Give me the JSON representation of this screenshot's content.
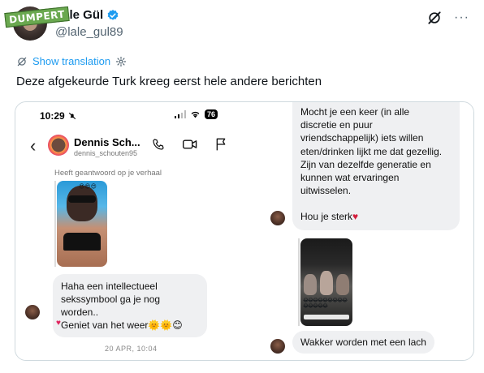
{
  "tweet": {
    "author_name": "Lale Gül",
    "handle": "@lale_gul89",
    "watermark": "DUMPERT",
    "translate_label": "Show translation",
    "text": "Deze afgekeurde Turk kreeg eerst hele andere berichten",
    "more_label": "···"
  },
  "phone": {
    "time": "10:29",
    "battery": "76",
    "chat_name": "Dennis Sch...",
    "chat_username": "dennis_schouten95",
    "reply_note": "Heeft geantwoord op je verhaal",
    "story_emoji": "😍😍😍",
    "msg1_line1": "Haha een intellectueel",
    "msg1_line2": "sekssymbool ga je nog worden..",
    "msg1_line3": "Geniet van het weer🌞🌞😊",
    "msg1_reaction": "♥",
    "timestamp": "20 APR, 10:04",
    "msg2_lines": [
      "Mocht je een keer (in alle",
      "discretie en puur",
      "vriendschappelijk) iets willen",
      "eten/drinken lijkt me dat gezellig.",
      "Zijn van dezelfde generatie en",
      "kunnen wat ervaringen",
      "uitwisselen."
    ],
    "msg2_closing": "Hou je sterk",
    "msg2_heart": "♥",
    "video_emojis": "😂😂😂😂😂😂😂😂😂😂😂😂😂😂",
    "msg3": "Wakker worden met een lach"
  },
  "icons": {
    "verified": "verified-badge-icon",
    "grok": "grok-icon",
    "more": "more-icon",
    "translate": "translate-icon",
    "settings": "gear-icon",
    "back": "chevron-left-icon",
    "phone": "phone-icon",
    "video": "video-icon",
    "flag": "flag-icon"
  },
  "colors": {
    "link": "#1d9bf0",
    "verified": "#1d9bf0",
    "bubble": "#eff0f2",
    "heart": "#d21e3c"
  }
}
